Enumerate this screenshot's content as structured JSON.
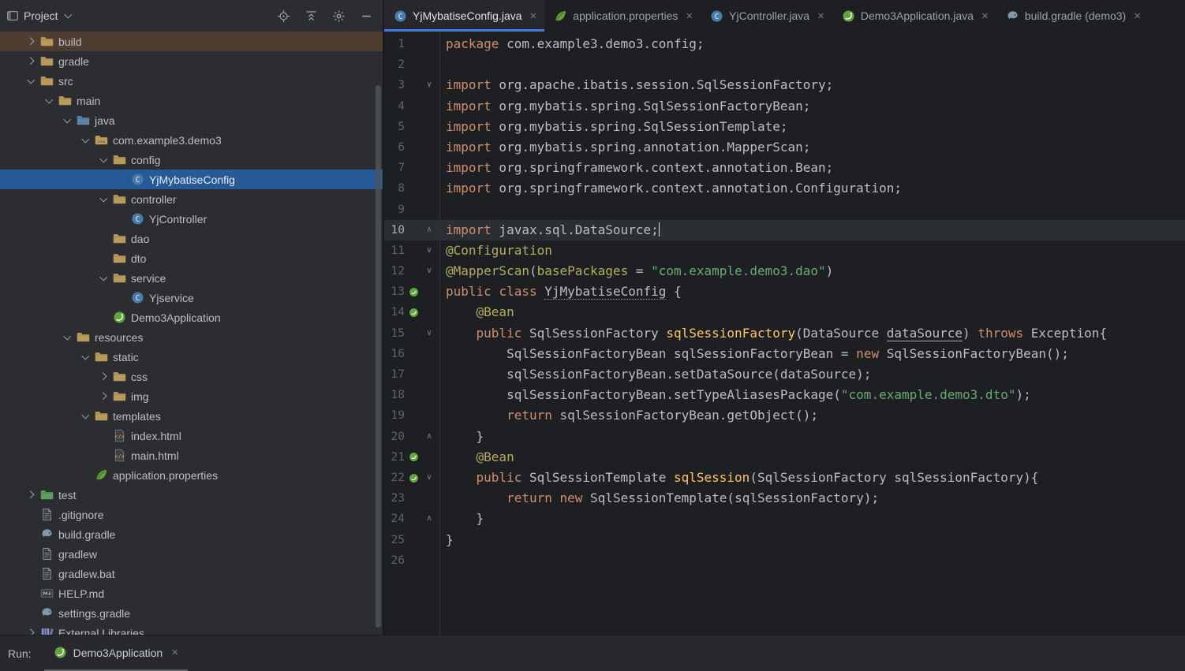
{
  "colors": {
    "selection_blue": "#255a96",
    "build_row_highlight": "#4d3e31",
    "tab_underline": "#3d7fe0",
    "keyword_orange": "#cf8e6d",
    "string_green": "#6aab73",
    "annotation_olive": "#b3ae60",
    "method_gold": "#ffc66b",
    "plain_code": "#bcbec4",
    "spring_green": "#65a33d",
    "editor_bg": "#1e1f22",
    "panel_bg": "#2b2d30"
  },
  "ui": {
    "close_glyph": "×"
  },
  "project_panel": {
    "title": "Project",
    "header_icons": [
      "locate-file",
      "collapse-all",
      "settings-gear",
      "hide-panel"
    ],
    "items": [
      {
        "label": "build",
        "level": 1,
        "chevron": "right",
        "icon": "folder",
        "state": "highlight"
      },
      {
        "label": "gradle",
        "level": 1,
        "chevron": "right",
        "icon": "folder"
      },
      {
        "label": "src",
        "level": 1,
        "chevron": "down",
        "icon": "folder"
      },
      {
        "label": "main",
        "level": 2,
        "chevron": "down",
        "icon": "folder"
      },
      {
        "label": "java",
        "level": 3,
        "chevron": "down",
        "icon": "folder-src"
      },
      {
        "label": "com.example3.demo3",
        "level": 4,
        "chevron": "down",
        "icon": "package"
      },
      {
        "label": "config",
        "level": 5,
        "chevron": "down",
        "icon": "folder"
      },
      {
        "label": "YjMybatiseConfig",
        "level": 6,
        "chevron": null,
        "icon": "class",
        "state": "selected"
      },
      {
        "label": "controller",
        "level": 5,
        "chevron": "down",
        "icon": "folder"
      },
      {
        "label": "YjController",
        "level": 6,
        "chevron": null,
        "icon": "class"
      },
      {
        "label": "dao",
        "level": 5,
        "chevron": null,
        "icon": "folder"
      },
      {
        "label": "dto",
        "level": 5,
        "chevron": null,
        "icon": "folder"
      },
      {
        "label": "service",
        "level": 5,
        "chevron": "down",
        "icon": "folder"
      },
      {
        "label": "Yjservice",
        "level": 6,
        "chevron": null,
        "icon": "class"
      },
      {
        "label": "Demo3Application",
        "level": 5,
        "chevron": null,
        "icon": "spring-boot"
      },
      {
        "label": "resources",
        "level": 3,
        "chevron": "down",
        "icon": "folder"
      },
      {
        "label": "static",
        "level": 4,
        "chevron": "down",
        "icon": "folder"
      },
      {
        "label": "css",
        "level": 5,
        "chevron": "right",
        "icon": "folder"
      },
      {
        "label": "img",
        "level": 5,
        "chevron": "right",
        "icon": "folder"
      },
      {
        "label": "templates",
        "level": 4,
        "chevron": "down",
        "icon": "folder"
      },
      {
        "label": "index.html",
        "level": 5,
        "chevron": null,
        "icon": "html"
      },
      {
        "label": "main.html",
        "level": 5,
        "chevron": null,
        "icon": "html"
      },
      {
        "label": "application.properties",
        "level": 4,
        "chevron": null,
        "icon": "spring-leaf"
      },
      {
        "label": "test",
        "level": 1,
        "chevron": "right",
        "icon": "folder-test"
      },
      {
        "label": ".gitignore",
        "level": 1,
        "chevron": null,
        "icon": "file"
      },
      {
        "label": "build.gradle",
        "level": 1,
        "chevron": null,
        "icon": "gradle"
      },
      {
        "label": "gradlew",
        "level": 1,
        "chevron": null,
        "icon": "file"
      },
      {
        "label": "gradlew.bat",
        "level": 1,
        "chevron": null,
        "icon": "file"
      },
      {
        "label": "HELP.md",
        "level": 1,
        "chevron": null,
        "icon": "md"
      },
      {
        "label": "settings.gradle",
        "level": 1,
        "chevron": null,
        "icon": "gradle"
      },
      {
        "label": "External Libraries",
        "level": 1,
        "chevron": "right",
        "icon": "lib"
      }
    ]
  },
  "editor_tabs": [
    {
      "label": "YjMybatiseConfig.java",
      "icon": "class",
      "active": true
    },
    {
      "label": "application.properties",
      "icon": "spring-leaf",
      "active": false
    },
    {
      "label": "YjController.java",
      "icon": "class",
      "active": false
    },
    {
      "label": "Demo3Application.java",
      "icon": "spring-boot",
      "active": false
    },
    {
      "label": "build.gradle (demo3)",
      "icon": "gradle",
      "active": false
    }
  ],
  "editor": {
    "file_name": "YjMybatiseConfig.java",
    "caret_line": 10,
    "lines": [
      {
        "n": 1,
        "t": [
          [
            "k",
            "package"
          ],
          [
            "p",
            " com.example3.demo3.config;"
          ]
        ]
      },
      {
        "n": 2,
        "t": []
      },
      {
        "n": 3,
        "fold": "down",
        "t": [
          [
            "k",
            "import"
          ],
          [
            "p",
            " org.apache.ibatis.session.SqlSessionFactory;"
          ]
        ]
      },
      {
        "n": 4,
        "t": [
          [
            "k",
            "import"
          ],
          [
            "p",
            " org.mybatis.spring.SqlSessionFactoryBean;"
          ]
        ]
      },
      {
        "n": 5,
        "t": [
          [
            "k",
            "import"
          ],
          [
            "p",
            " org.mybatis.spring.SqlSessionTemplate;"
          ]
        ]
      },
      {
        "n": 6,
        "t": [
          [
            "k",
            "import"
          ],
          [
            "p",
            " org.mybatis.spring.annotation.MapperScan;"
          ]
        ]
      },
      {
        "n": 7,
        "t": [
          [
            "k",
            "import"
          ],
          [
            "p",
            " org.springframework.context.annotation.Bean;"
          ]
        ]
      },
      {
        "n": 8,
        "t": [
          [
            "k",
            "import"
          ],
          [
            "p",
            " org.springframework.context.annotation.Configuration;"
          ]
        ]
      },
      {
        "n": 9,
        "t": []
      },
      {
        "n": 10,
        "current": true,
        "cursor": true,
        "fold": "up",
        "t": [
          [
            "k",
            "import"
          ],
          [
            "p",
            " javax.sql.DataSource;"
          ]
        ]
      },
      {
        "n": 11,
        "fold": "down",
        "t": [
          [
            "a",
            "@Configuration"
          ]
        ]
      },
      {
        "n": 12,
        "fold": "down",
        "t": [
          [
            "a",
            "@MapperScan"
          ],
          [
            "p",
            "("
          ],
          [
            "a",
            "basePackages"
          ],
          [
            "p",
            " = "
          ],
          [
            "s",
            "\"com.example.demo3.dao\""
          ],
          [
            "p",
            ")"
          ]
        ]
      },
      {
        "n": 13,
        "icons": [
          "bean"
        ],
        "t": [
          [
            "k",
            "public"
          ],
          [
            "p",
            " "
          ],
          [
            "k",
            "class"
          ],
          [
            "p",
            " "
          ],
          [
            "cu",
            "YjMybatiseConfig"
          ],
          [
            "p",
            " {"
          ]
        ]
      },
      {
        "n": 14,
        "icons": [
          "bean"
        ],
        "t": [
          [
            "p",
            "    "
          ],
          [
            "a",
            "@Bean"
          ]
        ]
      },
      {
        "n": 15,
        "fold": "down",
        "t": [
          [
            "p",
            "    "
          ],
          [
            "k",
            "public"
          ],
          [
            "p",
            " SqlSessionFactory "
          ],
          [
            "m",
            "sqlSessionFactory"
          ],
          [
            "p",
            "(DataSource "
          ],
          [
            "pu",
            "dataSource"
          ],
          [
            "p",
            ") "
          ],
          [
            "k",
            "throws"
          ],
          [
            "p",
            " Exception{"
          ]
        ]
      },
      {
        "n": 16,
        "t": [
          [
            "p",
            "        SqlSessionFactoryBean sqlSessionFactoryBean = "
          ],
          [
            "k",
            "new"
          ],
          [
            "p",
            " SqlSessionFactoryBean();"
          ]
        ]
      },
      {
        "n": 17,
        "t": [
          [
            "p",
            "        sqlSessionFactoryBean.setDataSource(dataSource);"
          ]
        ]
      },
      {
        "n": 18,
        "t": [
          [
            "p",
            "        sqlSessionFactoryBean.setTypeAliasesPackage("
          ],
          [
            "s",
            "\"com.example.demo3.dto\""
          ],
          [
            "p",
            ");"
          ]
        ]
      },
      {
        "n": 19,
        "t": [
          [
            "p",
            "        "
          ],
          [
            "k",
            "return"
          ],
          [
            "p",
            " sqlSessionFactoryBean.getObject();"
          ]
        ]
      },
      {
        "n": 20,
        "fold": "up",
        "t": [
          [
            "p",
            "    }"
          ]
        ]
      },
      {
        "n": 21,
        "icons": [
          "bean"
        ],
        "t": [
          [
            "p",
            "    "
          ],
          [
            "a",
            "@Bean"
          ]
        ]
      },
      {
        "n": 22,
        "icons": [
          "bean"
        ],
        "fold": "down",
        "t": [
          [
            "p",
            "    "
          ],
          [
            "k",
            "public"
          ],
          [
            "p",
            " SqlSessionTemplate "
          ],
          [
            "m",
            "sqlSession"
          ],
          [
            "p",
            "(SqlSessionFactory sqlSessionFactory){"
          ]
        ]
      },
      {
        "n": 23,
        "t": [
          [
            "p",
            "        "
          ],
          [
            "k",
            "return"
          ],
          [
            "p",
            " "
          ],
          [
            "k",
            "new"
          ],
          [
            "p",
            " SqlSessionTemplate(sqlSessionFactory);"
          ]
        ]
      },
      {
        "n": 24,
        "fold": "up",
        "t": [
          [
            "p",
            "    }"
          ]
        ]
      },
      {
        "n": 25,
        "t": [
          [
            "p",
            "}"
          ]
        ]
      },
      {
        "n": 26,
        "t": []
      }
    ]
  },
  "run_bar": {
    "label": "Run:",
    "tab_label": "Demo3Application",
    "tab_icon": "spring-boot"
  }
}
